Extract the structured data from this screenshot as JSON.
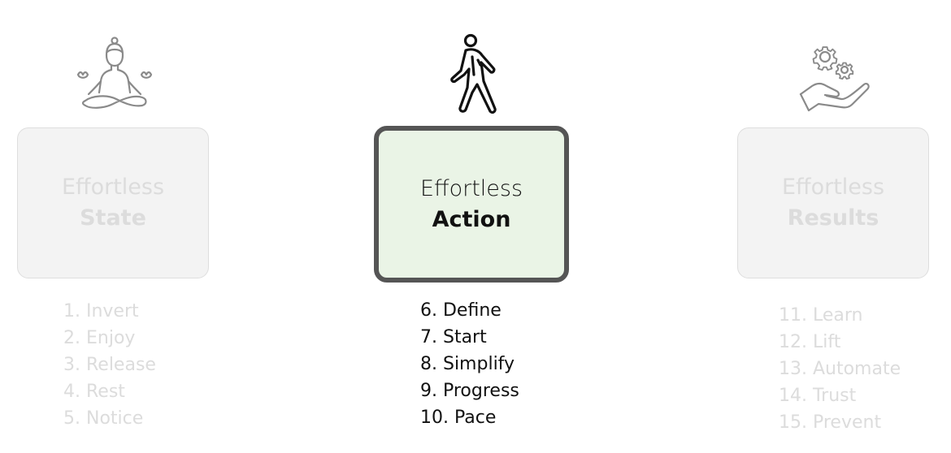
{
  "columns": [
    {
      "id": "state",
      "icon": "meditation-icon",
      "title_line1": "Effortless",
      "title_line2": "State",
      "active": false,
      "steps": [
        "1. Invert",
        "2. Enjoy",
        "3. Release",
        "4. Rest",
        "5. Notice"
      ]
    },
    {
      "id": "action",
      "icon": "walking-person-icon",
      "title_line1": "Effortless",
      "title_line2": "Action",
      "active": true,
      "steps": [
        "6. Define",
        "7. Start",
        "8. Simplify",
        "9. Progress",
        "10. Pace"
      ]
    },
    {
      "id": "results",
      "icon": "hand-with-gears-icon",
      "title_line1": "Effortless",
      "title_line2": "Results",
      "active": false,
      "steps": [
        "11. Learn",
        "12. Lift",
        "13. Automate",
        "14. Trust",
        "15. Prevent"
      ]
    }
  ],
  "colors": {
    "active_fill": "#eaf4e6",
    "active_border": "#555555",
    "active_text": "#111111",
    "inactive_fill": "#f3f3f3",
    "inactive_border": "#dedede",
    "inactive_text": "#dcdcdc",
    "icon_inactive": "#8a8a8a"
  }
}
